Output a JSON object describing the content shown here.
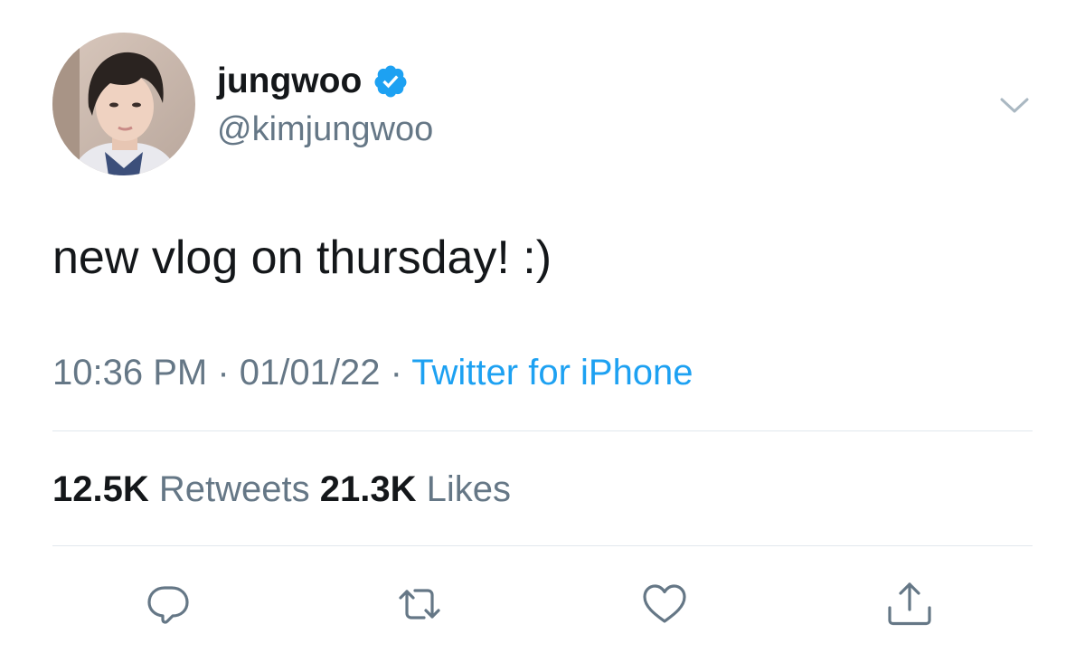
{
  "tweet": {
    "display_name": "jungwoo",
    "handle": "@kimjungwoo",
    "text": "new vlog on thursday! :)",
    "time": "10:36 PM",
    "date": "01/01/22",
    "separator": " · ",
    "source": "Twitter for iPhone",
    "verified": true
  },
  "stats": {
    "retweets_count": "12.5K",
    "retweets_label": "Retweets",
    "likes_count": "21.3K",
    "likes_label": "Likes"
  },
  "actions": [
    "reply-icon",
    "retweet-icon",
    "like-icon",
    "share-icon"
  ],
  "colors": {
    "text_primary": "#14171a",
    "text_secondary": "#657786",
    "accent": "#1da1f2",
    "divider": "#e1e8ed"
  }
}
